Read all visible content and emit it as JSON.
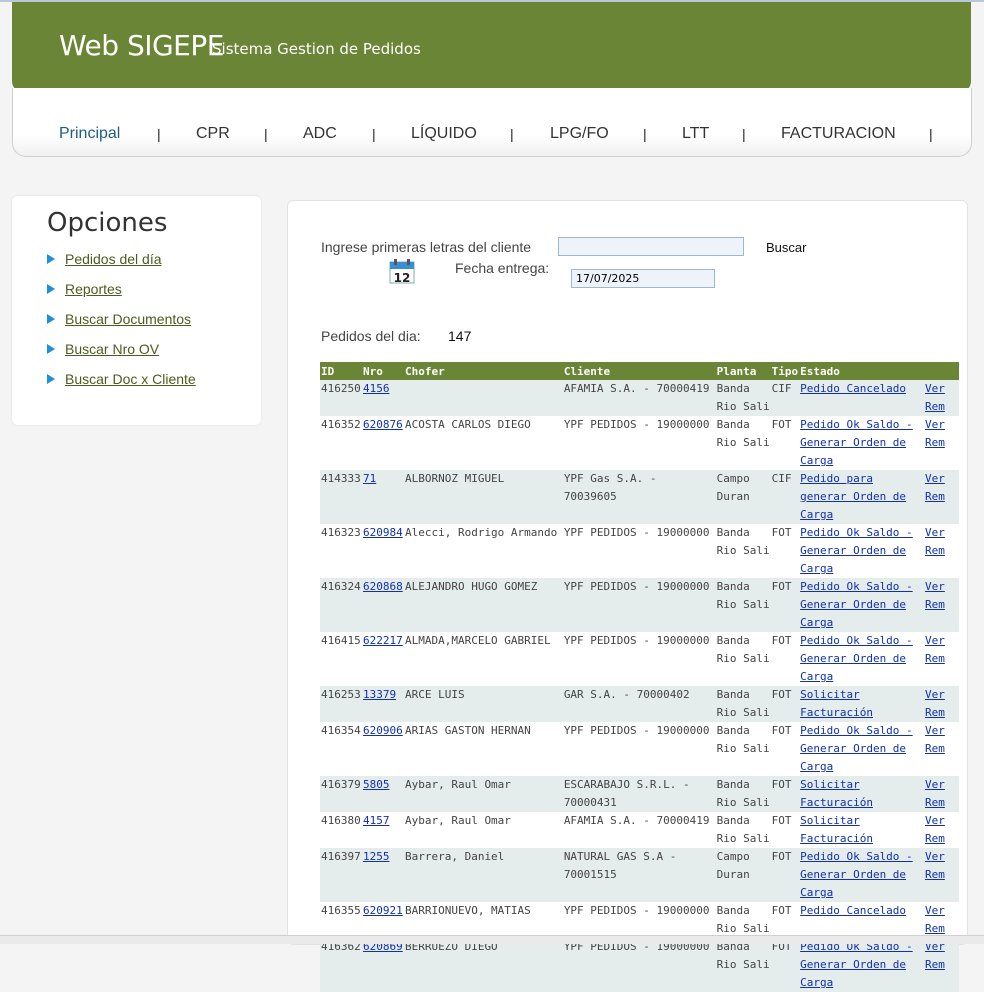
{
  "header": {
    "brand": "Web SIGEPE",
    "subtitle": "Sistema Gestion de Pedidos"
  },
  "nav": [
    {
      "label": "Principal"
    },
    {
      "label": "CPR"
    },
    {
      "label": "ADC"
    },
    {
      "label": "LÍQUIDO"
    },
    {
      "label": "LPG/FO"
    },
    {
      "label": "LTT"
    },
    {
      "label": "FACTURACION"
    }
  ],
  "sidebar": {
    "title": "Opciones",
    "links": [
      "Pedidos del día",
      "Reportes",
      "Buscar Documentos",
      "Buscar Nro OV",
      "Buscar Doc x Cliente"
    ]
  },
  "search": {
    "client_label": "Ingrese primeras letras del cliente",
    "client_value": "",
    "button": "Buscar",
    "date_label": "Fecha entrega:",
    "date_value": "17/07/2025",
    "calendar_text": "12"
  },
  "summary": {
    "label": "Pedidos del dia:",
    "count": "147"
  },
  "table": {
    "headers": [
      "ID",
      "Nro",
      "Chofer",
      "Cliente",
      "Planta",
      "Tipo",
      "Estado",
      ""
    ],
    "rows": [
      {
        "id": "416250",
        "nro": "4156",
        "chofer": "",
        "cliente": "AFAMIA S.A. - 70000419",
        "planta": "Banda Rio Sali",
        "tipo": "CIF",
        "estado": "Pedido Cancelado",
        "accion": "Ver Rem"
      },
      {
        "id": "416352",
        "nro": "620876",
        "chofer": "ACOSTA CARLOS DIEGO",
        "cliente": "YPF PEDIDOS - 19000000",
        "planta": "Banda Rio Sali",
        "tipo": "FOT",
        "estado": "Pedido Ok Saldo - Generar Orden de Carga",
        "accion": "Ver Rem"
      },
      {
        "id": "414333",
        "nro": "71",
        "chofer": "ALBORNOZ MIGUEL",
        "cliente": "YPF Gas S.A. - 70039605",
        "planta": "Campo Duran",
        "tipo": "CIF",
        "estado": "Pedido para generar Orden de Carga",
        "accion": "Ver Rem"
      },
      {
        "id": "416323",
        "nro": "620984",
        "chofer": "Alecci, Rodrigo Armando",
        "cliente": "YPF PEDIDOS - 19000000",
        "planta": "Banda Rio Sali",
        "tipo": "FOT",
        "estado": "Pedido Ok Saldo - Generar Orden de Carga",
        "accion": "Ver Rem"
      },
      {
        "id": "416324",
        "nro": "620868",
        "chofer": "ALEJANDRO HUGO GOMEZ",
        "cliente": "YPF PEDIDOS - 19000000",
        "planta": "Banda Rio Sali",
        "tipo": "FOT",
        "estado": "Pedido Ok Saldo - Generar Orden de Carga",
        "accion": "Ver Rem"
      },
      {
        "id": "416415",
        "nro": "622217",
        "chofer": "ALMADA,MARCELO GABRIEL",
        "cliente": "YPF PEDIDOS - 19000000",
        "planta": "Banda Rio Sali",
        "tipo": "FOT",
        "estado": "Pedido Ok Saldo - Generar Orden de Carga",
        "accion": "Ver Rem"
      },
      {
        "id": "416253",
        "nro": "13379",
        "chofer": "ARCE LUIS",
        "cliente": "GAR S.A. - 70000402",
        "planta": "Banda Rio Sali",
        "tipo": "FOT",
        "estado": "Solicitar Facturación",
        "accion": "Ver Rem"
      },
      {
        "id": "416354",
        "nro": "620906",
        "chofer": "ARIAS GASTON HERNAN",
        "cliente": "YPF PEDIDOS - 19000000",
        "planta": "Banda Rio Sali",
        "tipo": "FOT",
        "estado": "Pedido Ok Saldo - Generar Orden de Carga",
        "accion": "Ver Rem"
      },
      {
        "id": "416379",
        "nro": "5805",
        "chofer": "Aybar, Raul Omar",
        "cliente": "ESCARABAJO S.R.L. - 70000431",
        "planta": "Banda Rio Sali",
        "tipo": "FOT",
        "estado": "Solicitar Facturación",
        "accion": "Ver Rem"
      },
      {
        "id": "416380",
        "nro": "4157",
        "chofer": "Aybar, Raul Omar",
        "cliente": "AFAMIA S.A. - 70000419",
        "planta": "Banda Rio Sali",
        "tipo": "FOT",
        "estado": "Solicitar Facturación",
        "accion": "Ver Rem"
      },
      {
        "id": "416397",
        "nro": "1255",
        "chofer": "Barrera, Daniel",
        "cliente": "NATURAL GAS S.A - 70001515",
        "planta": "Campo Duran",
        "tipo": "FOT",
        "estado": "Pedido Ok Saldo - Generar Orden de Carga",
        "accion": "Ver Rem"
      },
      {
        "id": "416355",
        "nro": "620921",
        "chofer": "BARRIONUEVO, MATIAS",
        "cliente": "YPF PEDIDOS - 19000000",
        "planta": "Banda Rio Sali",
        "tipo": "FOT",
        "estado": "Pedido Cancelado",
        "accion": "Ver Rem"
      },
      {
        "id": "416362",
        "nro": "620869",
        "chofer": "BERRUEZO DIEGO",
        "cliente": "YPF PEDIDOS - 19000000",
        "planta": "Banda Rio Sali",
        "tipo": "FOT",
        "estado": "Pedido Ok Saldo - Generar Orden de Carga",
        "accion": "Ver Rem"
      }
    ]
  },
  "colors": {
    "brand_green": "#6a8535",
    "link_blue": "#1030b0",
    "row_alt": "#e5ecec",
    "arrow": "#1e90d6"
  }
}
